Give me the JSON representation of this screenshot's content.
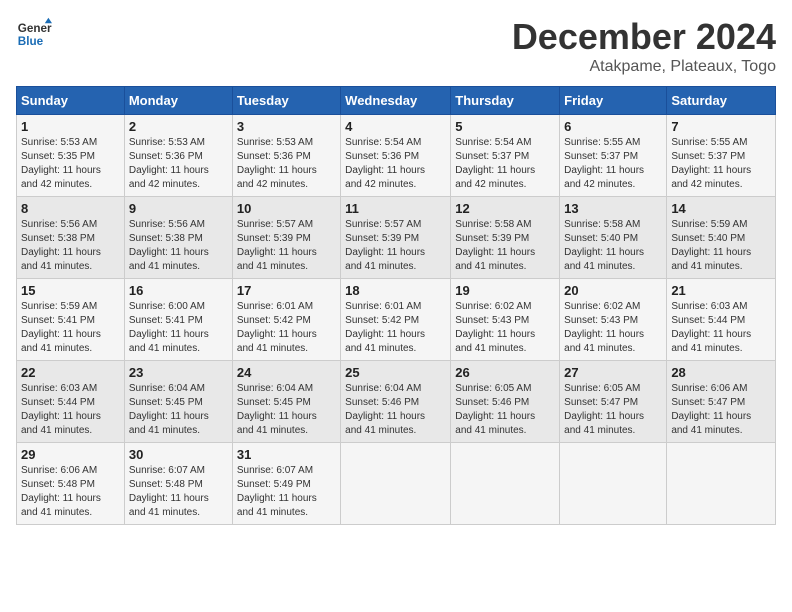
{
  "header": {
    "logo_line1": "General",
    "logo_line2": "Blue",
    "title": "December 2024",
    "subtitle": "Atakpame, Plateaux, Togo"
  },
  "days_of_week": [
    "Sunday",
    "Monday",
    "Tuesday",
    "Wednesday",
    "Thursday",
    "Friday",
    "Saturday"
  ],
  "weeks": [
    [
      {
        "day": "1",
        "info": "Sunrise: 5:53 AM\nSunset: 5:35 PM\nDaylight: 11 hours\nand 42 minutes."
      },
      {
        "day": "2",
        "info": "Sunrise: 5:53 AM\nSunset: 5:36 PM\nDaylight: 11 hours\nand 42 minutes."
      },
      {
        "day": "3",
        "info": "Sunrise: 5:53 AM\nSunset: 5:36 PM\nDaylight: 11 hours\nand 42 minutes."
      },
      {
        "day": "4",
        "info": "Sunrise: 5:54 AM\nSunset: 5:36 PM\nDaylight: 11 hours\nand 42 minutes."
      },
      {
        "day": "5",
        "info": "Sunrise: 5:54 AM\nSunset: 5:37 PM\nDaylight: 11 hours\nand 42 minutes."
      },
      {
        "day": "6",
        "info": "Sunrise: 5:55 AM\nSunset: 5:37 PM\nDaylight: 11 hours\nand 42 minutes."
      },
      {
        "day": "7",
        "info": "Sunrise: 5:55 AM\nSunset: 5:37 PM\nDaylight: 11 hours\nand 42 minutes."
      }
    ],
    [
      {
        "day": "8",
        "info": "Sunrise: 5:56 AM\nSunset: 5:38 PM\nDaylight: 11 hours\nand 41 minutes."
      },
      {
        "day": "9",
        "info": "Sunrise: 5:56 AM\nSunset: 5:38 PM\nDaylight: 11 hours\nand 41 minutes."
      },
      {
        "day": "10",
        "info": "Sunrise: 5:57 AM\nSunset: 5:39 PM\nDaylight: 11 hours\nand 41 minutes."
      },
      {
        "day": "11",
        "info": "Sunrise: 5:57 AM\nSunset: 5:39 PM\nDaylight: 11 hours\nand 41 minutes."
      },
      {
        "day": "12",
        "info": "Sunrise: 5:58 AM\nSunset: 5:39 PM\nDaylight: 11 hours\nand 41 minutes."
      },
      {
        "day": "13",
        "info": "Sunrise: 5:58 AM\nSunset: 5:40 PM\nDaylight: 11 hours\nand 41 minutes."
      },
      {
        "day": "14",
        "info": "Sunrise: 5:59 AM\nSunset: 5:40 PM\nDaylight: 11 hours\nand 41 minutes."
      }
    ],
    [
      {
        "day": "15",
        "info": "Sunrise: 5:59 AM\nSunset: 5:41 PM\nDaylight: 11 hours\nand 41 minutes."
      },
      {
        "day": "16",
        "info": "Sunrise: 6:00 AM\nSunset: 5:41 PM\nDaylight: 11 hours\nand 41 minutes."
      },
      {
        "day": "17",
        "info": "Sunrise: 6:01 AM\nSunset: 5:42 PM\nDaylight: 11 hours\nand 41 minutes."
      },
      {
        "day": "18",
        "info": "Sunrise: 6:01 AM\nSunset: 5:42 PM\nDaylight: 11 hours\nand 41 minutes."
      },
      {
        "day": "19",
        "info": "Sunrise: 6:02 AM\nSunset: 5:43 PM\nDaylight: 11 hours\nand 41 minutes."
      },
      {
        "day": "20",
        "info": "Sunrise: 6:02 AM\nSunset: 5:43 PM\nDaylight: 11 hours\nand 41 minutes."
      },
      {
        "day": "21",
        "info": "Sunrise: 6:03 AM\nSunset: 5:44 PM\nDaylight: 11 hours\nand 41 minutes."
      }
    ],
    [
      {
        "day": "22",
        "info": "Sunrise: 6:03 AM\nSunset: 5:44 PM\nDaylight: 11 hours\nand 41 minutes."
      },
      {
        "day": "23",
        "info": "Sunrise: 6:04 AM\nSunset: 5:45 PM\nDaylight: 11 hours\nand 41 minutes."
      },
      {
        "day": "24",
        "info": "Sunrise: 6:04 AM\nSunset: 5:45 PM\nDaylight: 11 hours\nand 41 minutes."
      },
      {
        "day": "25",
        "info": "Sunrise: 6:04 AM\nSunset: 5:46 PM\nDaylight: 11 hours\nand 41 minutes."
      },
      {
        "day": "26",
        "info": "Sunrise: 6:05 AM\nSunset: 5:46 PM\nDaylight: 11 hours\nand 41 minutes."
      },
      {
        "day": "27",
        "info": "Sunrise: 6:05 AM\nSunset: 5:47 PM\nDaylight: 11 hours\nand 41 minutes."
      },
      {
        "day": "28",
        "info": "Sunrise: 6:06 AM\nSunset: 5:47 PM\nDaylight: 11 hours\nand 41 minutes."
      }
    ],
    [
      {
        "day": "29",
        "info": "Sunrise: 6:06 AM\nSunset: 5:48 PM\nDaylight: 11 hours\nand 41 minutes."
      },
      {
        "day": "30",
        "info": "Sunrise: 6:07 AM\nSunset: 5:48 PM\nDaylight: 11 hours\nand 41 minutes."
      },
      {
        "day": "31",
        "info": "Sunrise: 6:07 AM\nSunset: 5:49 PM\nDaylight: 11 hours\nand 41 minutes."
      },
      null,
      null,
      null,
      null
    ]
  ]
}
